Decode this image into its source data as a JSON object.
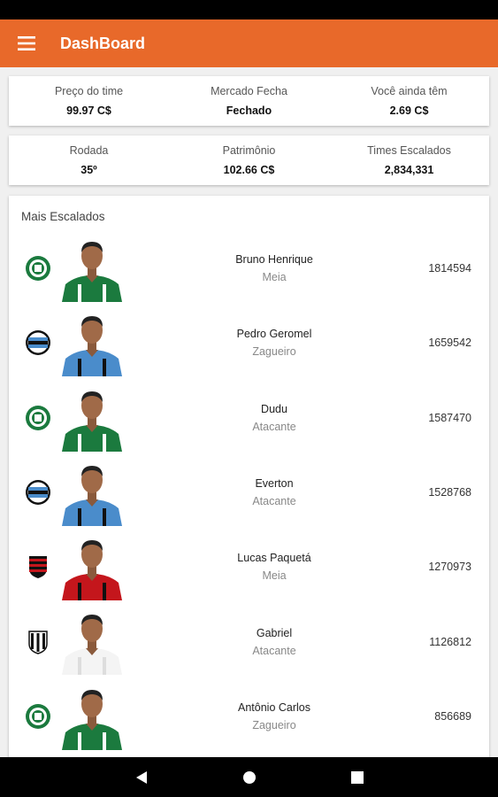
{
  "appbar": {
    "title": "DashBoard",
    "menu_icon": "hamburger-menu-icon"
  },
  "stats_row1": [
    {
      "label": "Preço do time",
      "value": "99.97 C$"
    },
    {
      "label": "Mercado Fecha",
      "value": "Fechado"
    },
    {
      "label": "Você ainda têm",
      "value": "2.69 C$"
    }
  ],
  "stats_row2": [
    {
      "label": "Rodada",
      "value": "35º"
    },
    {
      "label": "Patrimônio",
      "value": "102.66 C$"
    },
    {
      "label": "Times Escalados",
      "value": "2,834,331"
    }
  ],
  "most_picked": {
    "title": "Mais Escalados",
    "players": [
      {
        "name": "Bruno Henrique",
        "position": "Meia",
        "count": "1814594",
        "club": "palmeiras-crest-icon"
      },
      {
        "name": "Pedro Geromel",
        "position": "Zagueiro",
        "count": "1659542",
        "club": "gremio-crest-icon"
      },
      {
        "name": "Dudu",
        "position": "Atacante",
        "count": "1587470",
        "club": "palmeiras-crest-icon"
      },
      {
        "name": "Everton",
        "position": "Atacante",
        "count": "1528768",
        "club": "gremio-crest-icon"
      },
      {
        "name": "Lucas Paquetá",
        "position": "Meia",
        "count": "1270973",
        "club": "flamengo-crest-icon"
      },
      {
        "name": "Gabriel",
        "position": "Atacante",
        "count": "1126812",
        "club": "santos-crest-icon"
      },
      {
        "name": "Antônio Carlos",
        "position": "Zagueiro",
        "count": "856689",
        "club": "palmeiras-crest-icon"
      }
    ]
  },
  "colors": {
    "accent": "#e8692a",
    "palmeiras": "#1b7a3e",
    "gremio": "#4a8ccb",
    "flamengo": "#c4161c",
    "santos": "#111111"
  },
  "navbar": {
    "back": "back-triangle-icon",
    "home": "home-circle-icon",
    "recents": "recents-square-icon"
  }
}
